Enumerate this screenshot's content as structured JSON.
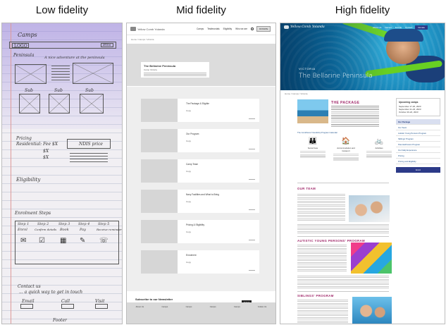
{
  "headers": {
    "low": "Low fidelity",
    "mid": "Mid fidelity",
    "high": "High fidelity"
  },
  "low_fi": {
    "camps": "Camps",
    "logo": "LOGO",
    "button": "Btns",
    "heading": "Peninsula",
    "tagline": "A nice adventure at the peninsula",
    "icon_labels": [
      "Sub",
      "Sub",
      "Sub"
    ],
    "pricing": "Pricing",
    "price_lines": [
      "Residential: Fee $X",
      "$X",
      "$X"
    ],
    "ndis": "NDIS price",
    "eligibility": "Eligibility",
    "steps_title": "Enrolment Steps",
    "steps": [
      "Step 1",
      "Step 2",
      "Step 3",
      "Step 4",
      "Step 5"
    ],
    "step_labels": [
      "Enrol",
      "Confirm details",
      "Book",
      "Pay",
      "Receive reminder"
    ],
    "contact_title": "Contact us",
    "contact_text": "... a quick way to get in touch",
    "contact_buttons": [
      "Email",
      "Call",
      "Visit"
    ],
    "footer": "Footer"
  },
  "mid_fi": {
    "logo": "Yellow Comb Yolanda",
    "nav": [
      "Camps",
      "Testimonials",
      "Eligibility",
      "Who we are"
    ],
    "donate": "DONATE",
    "breadcrumb": "Home / Camps / Victoria",
    "hero_title": "The Bellarine Peninsula",
    "hero_kicker": "Camp Victoria",
    "cards": [
      {
        "title": "The Package & Eligible",
        "copy": "Copy"
      },
      {
        "title": "Our Program",
        "copy": "Copy"
      },
      {
        "title": "Camp Team",
        "copy": "Copy"
      },
      {
        "title": "Navy Facilities and What to Bring",
        "copy": "Copy"
      },
      {
        "title": "Pricing & Eligibility",
        "copy": "Copy"
      },
      {
        "title": "Enrolment",
        "copy": "Copy"
      }
    ],
    "newsletter_title": "Subscribe to our Newsletter",
    "newsletter_sub": "Be kept in the loop get news event details and more.",
    "newsletter_button": "Submit",
    "footer_cols": [
      "About Us",
      "Camps",
      "Camps",
      "Camps",
      "Camps",
      "Follow Us"
    ]
  },
  "high_fi": {
    "logo": "Yellow Comb Yolanda",
    "nav": [
      "About Us",
      "Camps",
      "Events",
      "Contact"
    ],
    "donate": "Donate",
    "kicker": "VICTORIA",
    "title": "The Bellarine Peninsula",
    "breadcrumb": "Home / Camps / Victoria",
    "package_heading": "THE PACKAGE",
    "package_link": "The Contributor Friendship Program Calendar",
    "icons": [
      {
        "glyph": "👪",
        "label": "Social Care"
      },
      {
        "glyph": "🏠",
        "label": "Accommodation and transport"
      },
      {
        "glyph": "🚲",
        "label": "Activities"
      }
    ],
    "sidebar_title": "Upcoming camps",
    "sidebar_dates": [
      "September 17-20, 2023",
      "September 21-23, 2023",
      "October 20-22, 2023"
    ],
    "sidebar_menu": [
      "Our Package",
      "Our Team",
      "Autistic Young Persons Program",
      "Siblings' Program",
      "Parental/Carers Program",
      "Our Daily Experience",
      "Pricing",
      "Pricing and Eligibility"
    ],
    "sidebar_button": "Enrol",
    "team_heading": "OUR TEAM",
    "autism_heading": "AUTISTIC YOUNG PERSONS' PROGRAM",
    "siblings_heading": "SIBLINGS' PROGRAM"
  }
}
